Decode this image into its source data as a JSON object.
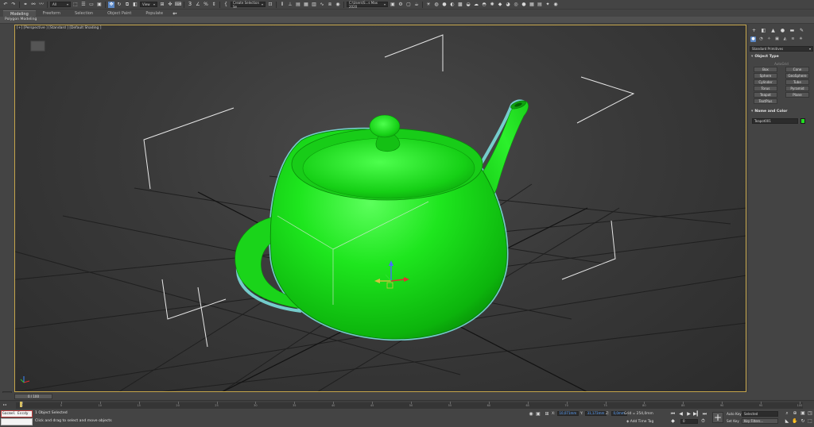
{
  "toolbar": {
    "filter_value": "All",
    "view_value": "View",
    "selection_set_placeholder": "Create Selection Se",
    "project_path": "C:\\Users\\S...s Max 2020",
    "snap_label": "3",
    "icons": [
      "undo-icon",
      "redo-icon",
      "link-icon",
      "unlink-icon",
      "bind-spacewarp-icon",
      "select-object-icon",
      "select-by-name-icon",
      "rectangle-region-icon",
      "window-crossing-icon",
      "select-move-icon",
      "select-rotate-icon",
      "select-scale-icon",
      "pivot-icon",
      "select-manipulate-icon",
      "keyboard-shortcut-icon",
      "snaps-toggle-icon",
      "angle-snap-icon",
      "percent-snap-icon",
      "spinner-snap-icon",
      "edit-named-selection-icon",
      "mirror-icon",
      "align-icon",
      "toggle-scene-explorer-icon",
      "toggle-layer-explorer-icon",
      "curve-editor-icon",
      "schematic-view-icon",
      "material-editor-icon",
      "render-setup-icon",
      "rendered-frame-window-icon",
      "render-icon"
    ]
  },
  "ribbon": {
    "tabs": [
      "Modeling",
      "Freeform",
      "Selection",
      "Object Paint",
      "Populate"
    ],
    "active_tab": "Modeling",
    "panel_label": "Polygon Modeling"
  },
  "viewport": {
    "label": "[+] [Perspective ] [Standard ] [Default Shading ]",
    "object_color": "#22ee22",
    "selection_outline_color": "#7fe6e6"
  },
  "command_panel": {
    "dropdown_value": "Standard Primitives",
    "object_type_title": "Object Type",
    "autogrid_label": "AutoGrid",
    "primitives": [
      "Box",
      "Cone",
      "Sphere",
      "GeoSphere",
      "Cylinder",
      "Tube",
      "Torus",
      "Pyramid",
      "Teapot",
      "Plane",
      "TextPlus"
    ],
    "name_color_title": "Name and Color",
    "object_name": "Teapot001",
    "object_color": "#22dd22"
  },
  "timeline": {
    "slider_label": "0 / 100",
    "ticks": [
      "0",
      "5",
      "10",
      "15",
      "20",
      "25",
      "30",
      "35",
      "40",
      "45",
      "50",
      "55",
      "60",
      "65",
      "70",
      "75",
      "80",
      "85",
      "90",
      "95",
      "100"
    ]
  },
  "statusbar": {
    "maxscript_text": "Gacmel Escdy",
    "status_line_1": "1 Object Selected",
    "status_line_2": "Click and drag to select and move objects",
    "x_label": "X:",
    "x_value": "10,071mm",
    "y_label": "Y:",
    "y_value": "31,173mm",
    "z_label": "Z:",
    "z_value": "0,0mm",
    "grid_text": "Grid = 254,0mm",
    "add_time_tag": "Add Time Tag",
    "auto_key": "Auto Key",
    "set_key": "Set Key",
    "selected_value": "Selected",
    "key_filters": "Key Filters...",
    "frame_value": "0"
  }
}
